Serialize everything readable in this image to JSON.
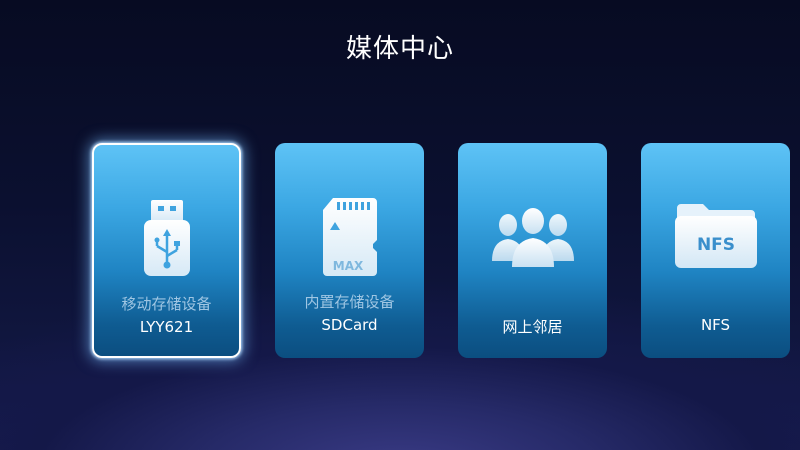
{
  "title": "媒体中心",
  "tiles": [
    {
      "subtitle": "移动存储设备",
      "label": "LYY621",
      "icon": "usb-drive-icon",
      "selected": true
    },
    {
      "subtitle": "内置存储设备",
      "label": "SDCard",
      "icon": "sd-card-icon",
      "icon_text": "MAX"
    },
    {
      "subtitle": "",
      "label": "网上邻居",
      "icon": "network-users-icon"
    },
    {
      "subtitle": "",
      "label": "NFS",
      "icon": "nfs-folder-icon",
      "icon_text": "NFS"
    }
  ],
  "colors": {
    "tile_top": "#5ec3f6",
    "tile_bottom": "#0b4e80",
    "background": "#0b1030"
  }
}
